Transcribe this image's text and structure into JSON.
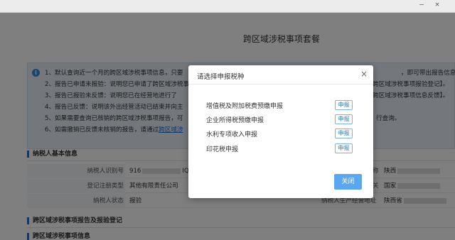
{
  "browser": {
    "minimize": "—",
    "close": "✕"
  },
  "page": {
    "title": "跨区域涉税事项套餐"
  },
  "notice": {
    "line1_left": "1、默认查询近一个月的跨区域涉税事项信息，只要",
    "line1_right": "，即可带出报告信息。",
    "line2_left": "2、报告已申请未报验：说明您已申请了跨区域涉税事",
    "line2_right": "跨区域涉税事项报验登记】。",
    "line3_left": "3、报告已报验未反馈：说明您已在经营地进行了",
    "line3_right": "跨区域涉税事项信息反馈】。",
    "line4_left": "4、报告已反馈：说明该外出经营活动已结束并向主",
    "line5_left": "5、如果需要查询已核销的跨区域涉税事项报告，可",
    "line5_right": "行查询。",
    "line6_left": "6、如需撤销已反馈未核销的报告，请通过",
    "line6_link": "跨区域涉"
  },
  "section1": {
    "title": "纳税人基本信息",
    "rows": [
      {
        "label": "纳税人识别号",
        "value_prefix": "916",
        "value_suffix": "IQ",
        "right_label": "称",
        "right_value": "陕西"
      },
      {
        "label": "登记注册类型",
        "value": "其他有限责任公司",
        "right_label": "关",
        "right_value": "国家"
      },
      {
        "label": "纳税人状态",
        "value": "报验",
        "right_label": "纳税人生产经营地址",
        "right_value": "陕西省"
      }
    ]
  },
  "section2": {
    "title": "跨区域涉税事项报告及报验登记"
  },
  "section3": {
    "title": "跨区域涉税事项信息"
  },
  "modal": {
    "title": "请选择申报税种",
    "close_icon": "×",
    "items": [
      {
        "name": "增值税及附加税费预缴申报",
        "button": "申报"
      },
      {
        "name": "企业所得税预缴申报",
        "button": "申报"
      },
      {
        "name": "水利专项收入申报",
        "button": "申报"
      },
      {
        "name": "印花税申报",
        "button": "申报"
      }
    ],
    "close_button": "关闭"
  }
}
